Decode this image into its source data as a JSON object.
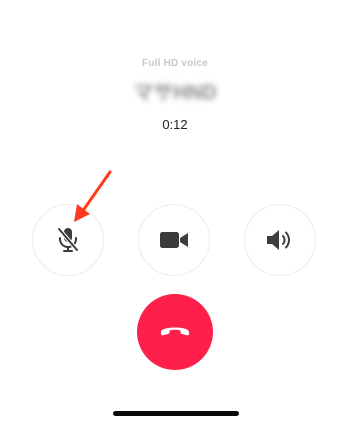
{
  "call": {
    "voice_quality": "Full HD voice",
    "caller_name": "マサHND",
    "timer": "0:12"
  },
  "controls": {
    "mute_icon": "mic-off-icon",
    "video_icon": "video-camera-icon",
    "speaker_icon": "speaker-icon",
    "end_icon": "phone-hangup-icon"
  },
  "colors": {
    "end_call": "#ff1f4b",
    "icon": "#3c3c3c",
    "annotation_arrow": "#ff3b1f"
  }
}
